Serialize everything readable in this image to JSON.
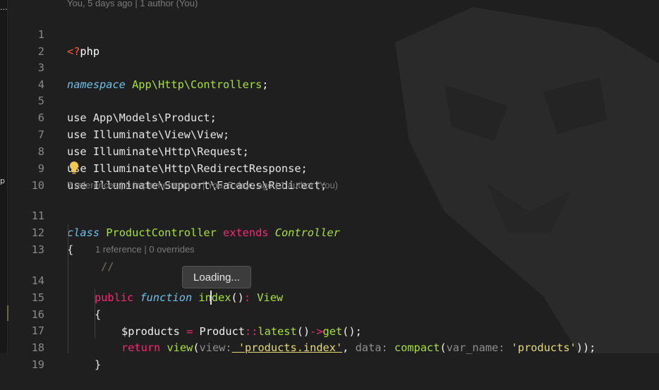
{
  "left_strip": {
    "glyph_top": "...",
    "glyph_mid": "p"
  },
  "blame_header": "You, 5 days ago | 1 author (You)",
  "codelens": {
    "class_info": "7 references | 0 implementations | You, 5 days ago | 1 author (You)",
    "method_info": "1 reference | 0 overrides"
  },
  "tooltip": "Loading...",
  "line_numbers": [
    "1",
    "2",
    "3",
    "4",
    "5",
    "6",
    "7",
    "8",
    "9",
    "10",
    "11",
    "12",
    "13",
    "14",
    "15",
    "16",
    "17",
    "18",
    "19"
  ],
  "code": {
    "l1_open": "<?",
    "l1_php": "php",
    "l3_ns": "namespace",
    "l3_path": " App\\Http\\Controllers",
    "l3_semi": ";",
    "l5": "use App\\Models\\Product;",
    "l6": "use Illuminate\\View\\View;",
    "l7": "use Illuminate\\Http\\Request;",
    "l8": "use Illuminate\\Http\\RedirectResponse;",
    "l9": "use Illuminate\\Support\\Facades\\Redirect;",
    "l11_class": "class",
    "l11_name": " ProductController",
    "l11_extends": " extends",
    "l11_parent": " Controller",
    "l12": "{",
    "l13": "//",
    "l14_public": "public",
    "l14_function": " function",
    "l14_index": " index",
    "l14_parens": "()",
    "l14_colon": ":",
    "l14_type": " View",
    "l15": "{",
    "l16_var": "$products",
    "l16_eq": " = ",
    "l16_class": "Product",
    "l16_dc": "::",
    "l16_latest": "latest",
    "l16_p1": "()",
    "l16_arrow": "->",
    "l16_get": "get",
    "l16_end": "();",
    "l17_return": "return",
    "l17_view": " view",
    "l17_open": "(",
    "l17_hint1": "view:",
    "l17_str1": " 'products.index'",
    "l17_comma": ", ",
    "l17_hint2": "data:",
    "l17_compact": " compact",
    "l17_open2": "(",
    "l17_hint3": "var_name:",
    "l17_str2": " 'products'",
    "l17_close": "));",
    "l18": "}"
  },
  "colors": {
    "background": "#1f1f1f",
    "keyword_pink": "#f92672",
    "type_green": "#a6e22e",
    "string_yellow": "#e6db74",
    "namespace_blue": "#6dc1e8"
  },
  "icons": [
    "lightbulb-icon"
  ]
}
